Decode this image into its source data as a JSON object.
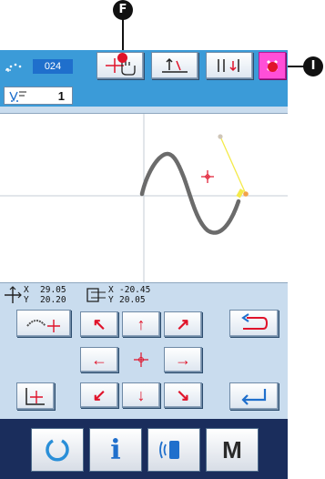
{
  "callouts": {
    "top_label": "F",
    "right_label": "I"
  },
  "header": {
    "pattern_number": "024",
    "stitch_count": "1"
  },
  "coords": {
    "current_x": "29.05",
    "current_y": "20.20",
    "relative_x": "-20.45",
    "relative_y": "20.05",
    "x_label": "X",
    "y_label": "Y"
  },
  "bottom": {
    "memory_label": "M",
    "info_label": "i"
  },
  "colors": {
    "accent": "#3b9bd8",
    "close": "#ff4fd8",
    "dark_bar": "#1a2d5c",
    "arrow": "#e0132a"
  }
}
